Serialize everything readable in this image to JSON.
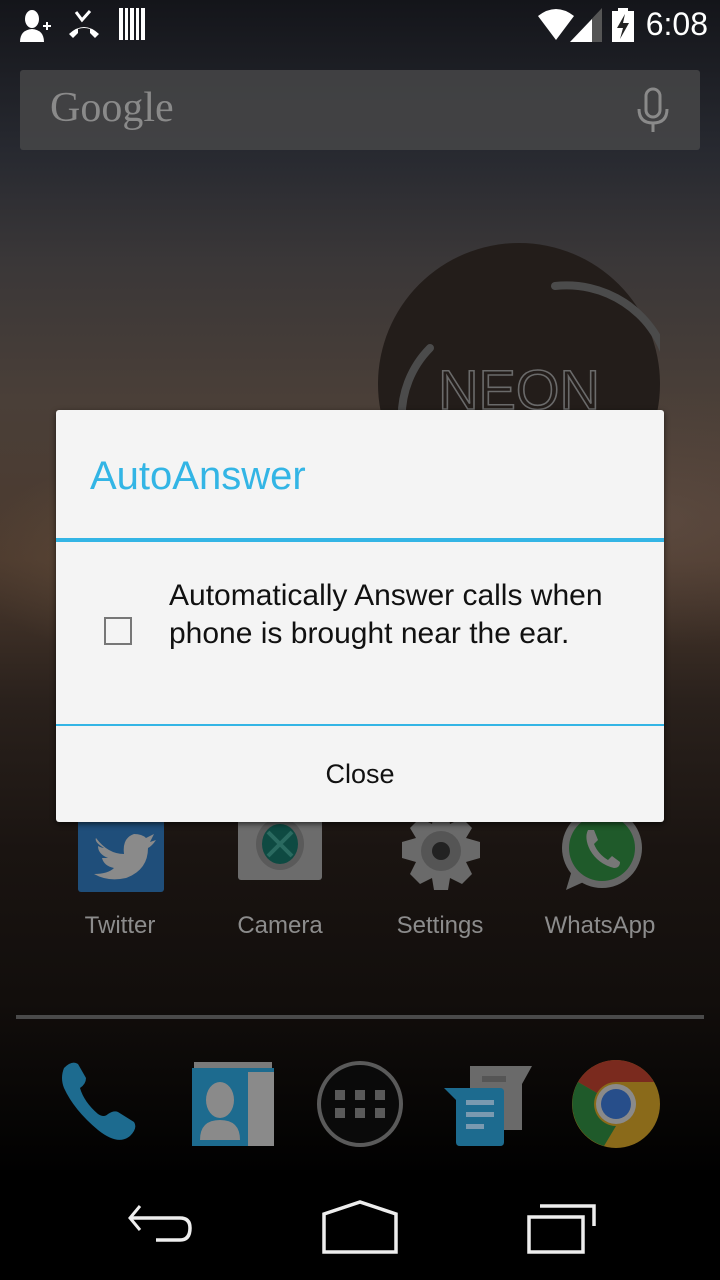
{
  "status_bar": {
    "left_icons": [
      "add-contact-icon",
      "missed-call-icon",
      "barcode-icon"
    ],
    "right_icons": [
      "wifi-icon",
      "signal-icon",
      "battery-charging-icon"
    ],
    "time": "6:08"
  },
  "search_widget": {
    "logo_text": "Google",
    "voice_icon": "mic-icon"
  },
  "clock_widget": {
    "label": "NEON"
  },
  "dialog": {
    "title": "AutoAnswer",
    "checkbox_checked": false,
    "message": "Automatically Answer calls when phone is brought near the ear.",
    "close_label": "Close",
    "accent_color": "#33b5e5"
  },
  "home_apps": [
    {
      "label": "Twitter",
      "icon": "twitter-icon"
    },
    {
      "label": "Camera",
      "icon": "camera-icon"
    },
    {
      "label": "Settings",
      "icon": "settings-gear-icon"
    },
    {
      "label": "WhatsApp",
      "icon": "whatsapp-icon"
    }
  ],
  "dock": [
    {
      "name": "Phone",
      "icon": "phone-icon"
    },
    {
      "name": "People",
      "icon": "contacts-icon"
    },
    {
      "name": "Apps",
      "icon": "app-drawer-icon"
    },
    {
      "name": "Messaging",
      "icon": "messaging-icon"
    },
    {
      "name": "Chrome",
      "icon": "chrome-icon"
    }
  ],
  "nav_bar": {
    "buttons": [
      "back",
      "home",
      "recents"
    ]
  }
}
